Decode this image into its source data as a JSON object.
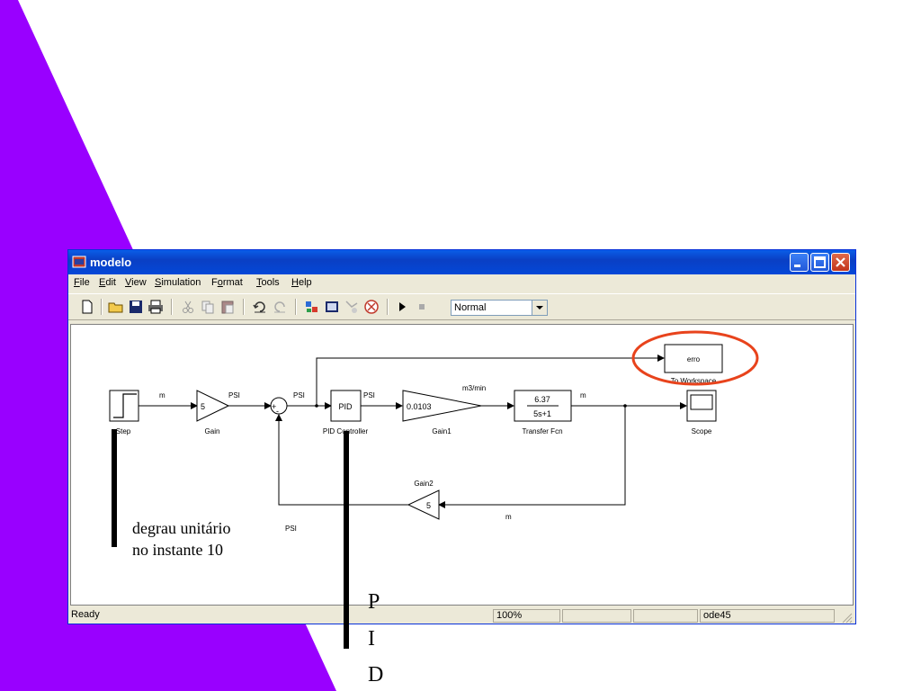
{
  "window": {
    "title": "modelo"
  },
  "menu": [
    "File",
    "Edit",
    "View",
    "Simulation",
    "Format",
    "Tools",
    "Help"
  ],
  "menu_underline": [
    "F",
    "E",
    "V",
    "S",
    "o",
    "T",
    "H"
  ],
  "toolbar": {
    "icons": [
      "new-icon",
      "open-icon",
      "save-icon",
      "print-icon",
      "cut-icon",
      "copy-icon",
      "paste-icon",
      "undo-icon",
      "redo-icon",
      "library-browser-icon",
      "model-explorer-icon",
      "debugger-icon",
      "build-icon",
      "start-simulation-icon",
      "stop-simulation-icon"
    ],
    "mode_value": "Normal"
  },
  "diagram": {
    "blocks": {
      "step": "Step",
      "gain": "Gain",
      "gain_value": "5",
      "sum_signs": [
        "+",
        "-"
      ],
      "pid": "PID Controller",
      "pid_value": "PID",
      "gain1": "Gain1",
      "gain1_value": "0.0103",
      "tf": "Transfer Fcn",
      "tf_num": "6.37",
      "tf_den": "5s+1",
      "scope": "Scope",
      "workspace": "To Workspace",
      "workspace_value": "erro",
      "gain2": "Gain2",
      "gain2_value": "5"
    },
    "signals": {
      "m1": "m",
      "psi1": "PSI",
      "psi2": "PSI",
      "psi3": "PSI",
      "m3min": "m3/min",
      "m2": "m",
      "m_fb": "m",
      "psi_fb": "PSI"
    }
  },
  "status": {
    "state": "Ready",
    "zoom": "100%",
    "solver": "ode45"
  },
  "annotations": {
    "step_note_line1": "degrau unitário",
    "step_note_line2": "no instante 10",
    "pid_letters": [
      "P",
      "I",
      "D"
    ]
  },
  "colors": {
    "slide_accent": "#9900ff",
    "highlight_circle": "#e8431c",
    "titlebar": "#0a5ee8"
  }
}
